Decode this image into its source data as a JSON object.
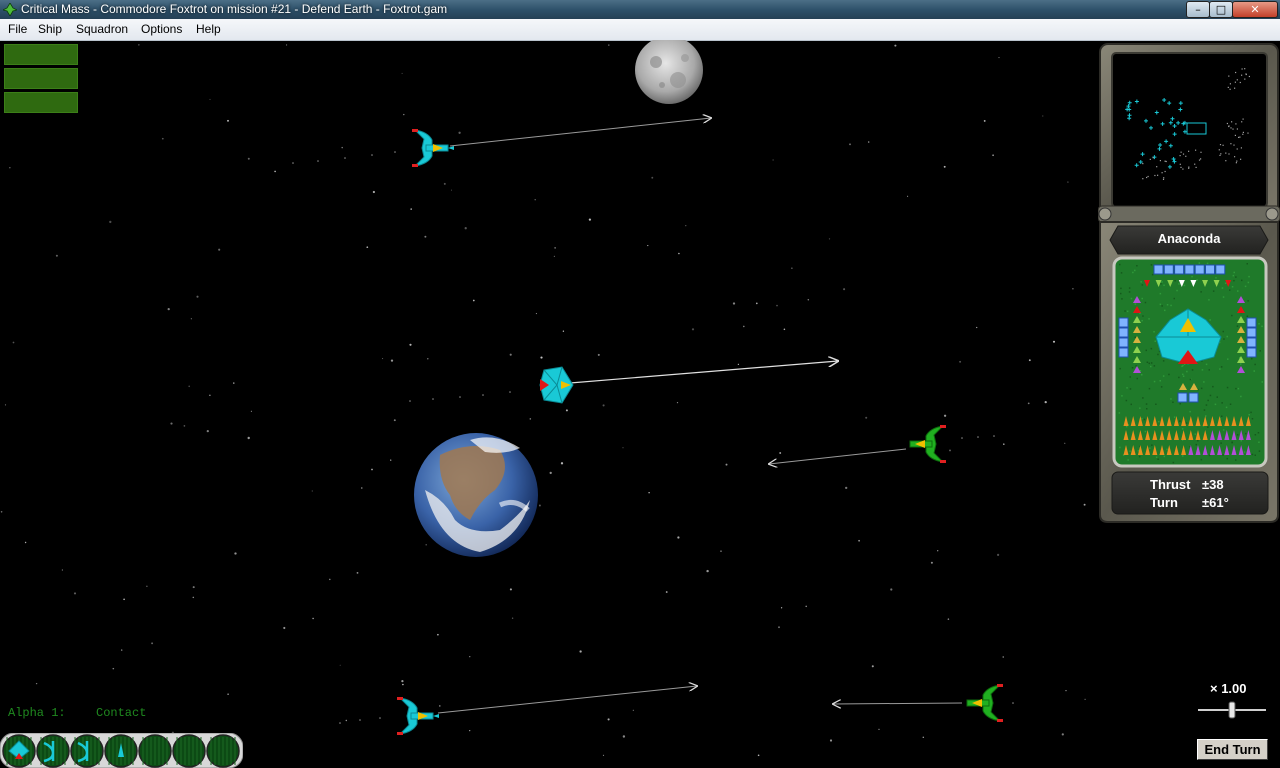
{
  "window": {
    "title": "Critical Mass - Commodore Foxtrot on mission #21 - Defend Earth - Foxtrot.gam",
    "min_glyph": "–",
    "max_glyph": "□",
    "close_glyph": "✕",
    "icon": "app-ship-icon"
  },
  "menubar": [
    "File",
    "Ship",
    "Squadron",
    "Options",
    "Help"
  ],
  "colors": {
    "friendly": "#19c9d6",
    "enemy": "#20b020",
    "panel_green": "#1f7a2a",
    "status_text": "#1f8a1f"
  },
  "squadron_buttons": [
    "",
    "",
    ""
  ],
  "ship_panel": {
    "name": "Anaconda",
    "thrust_label": "Thrust",
    "thrust_value": "±38",
    "turn_label": "Turn",
    "turn_value": "±61°"
  },
  "status": {
    "unit": "Alpha 1:",
    "message": "Contact"
  },
  "controls": {
    "zoom_label": "× 1.00",
    "zoom_level": 0.5,
    "end_turn_label": "End Turn"
  },
  "tray_icons": [
    "hull-icon",
    "ship-icon",
    "ship-icon",
    "ship-small-icon",
    "empty-slot-icon",
    "empty-slot-icon",
    "empty-slot-icon"
  ]
}
